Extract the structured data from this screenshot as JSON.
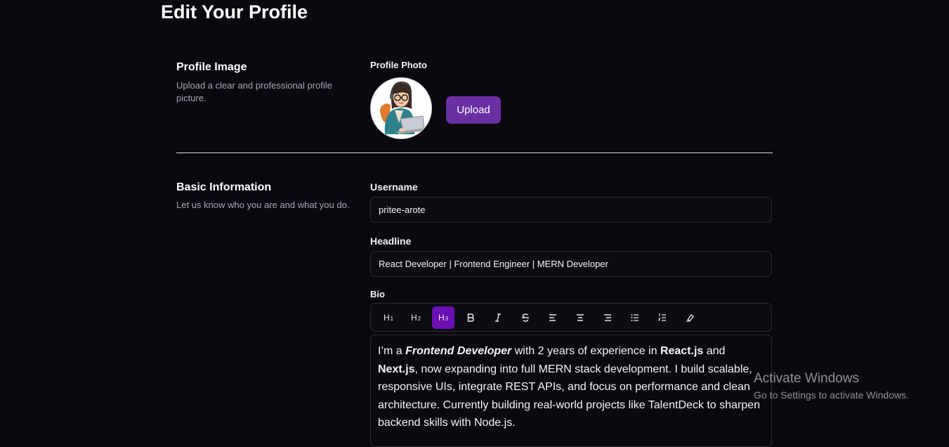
{
  "page": {
    "title": "Edit Your Profile"
  },
  "profile_image": {
    "title": "Profile Image",
    "description": "Upload a clear and professional profile picture.",
    "photo_label": "Profile Photo",
    "upload_label": "Upload"
  },
  "basic_info": {
    "title": "Basic Information",
    "description": "Let us know who you are and what you do.",
    "username_label": "Username",
    "username_value": "pritee-arote",
    "headline_label": "Headline",
    "headline_value": "React Developer | Frontend Engineer | MERN Developer",
    "bio_label": "Bio"
  },
  "toolbar": {
    "buttons": [
      {
        "name": "heading-1",
        "label": "H",
        "sub": "1",
        "icon": "h1-icon",
        "active": false
      },
      {
        "name": "heading-2",
        "label": "H",
        "sub": "2",
        "icon": "h2-icon",
        "active": false
      },
      {
        "name": "heading-3",
        "label": "H",
        "sub": "3",
        "icon": "h3-icon",
        "active": true
      },
      {
        "name": "bold",
        "icon": "bold-icon",
        "active": false
      },
      {
        "name": "italic",
        "icon": "italic-icon",
        "active": false
      },
      {
        "name": "strikethrough",
        "icon": "strikethrough-icon",
        "active": false
      },
      {
        "name": "align-left",
        "icon": "align-left-icon",
        "active": false
      },
      {
        "name": "align-center",
        "icon": "align-center-icon",
        "active": false
      },
      {
        "name": "align-right",
        "icon": "align-right-icon",
        "active": false
      },
      {
        "name": "bullet-list",
        "icon": "bullet-list-icon",
        "active": false
      },
      {
        "name": "ordered-list",
        "icon": "ordered-list-icon",
        "active": false
      },
      {
        "name": "clear-format",
        "icon": "clear-format-icon",
        "active": false
      }
    ]
  },
  "bio": {
    "t1": "I’m a ",
    "b1": "Frontend Developer",
    "t2": " with 2 years of experience in ",
    "b2": "React.js",
    "t3": " and ",
    "b3": "Next.js",
    "t4": ", now expanding into full MERN stack development. I build scalable, responsive UIs, integrate REST APIs, and focus on performance and clean architecture. Currently building real-world projects like TalentDeck to sharpen backend skills with Node.js."
  },
  "watermark": {
    "title": "Activate Windows",
    "subtitle": "Go to Settings to activate Windows."
  },
  "colors": {
    "background": "#0b090f",
    "accent": "#6a2fa3",
    "active_tool": "#6a0fb3",
    "border": "#2c2a35"
  }
}
